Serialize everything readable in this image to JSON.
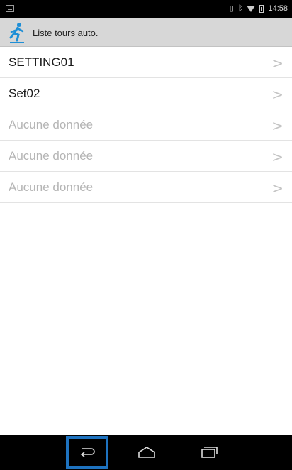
{
  "status_bar": {
    "time": "14:58",
    "icons": [
      "notification-icon",
      "vibrate-icon",
      "bluetooth-icon",
      "wifi-icon",
      "battery-icon"
    ]
  },
  "action_bar": {
    "title": "Liste tours auto.",
    "app_icon": "runner-icon"
  },
  "list": {
    "items": [
      {
        "label": "SETTING01",
        "empty": false
      },
      {
        "label": "Set02",
        "empty": false
      },
      {
        "label": "Aucune donnée",
        "empty": true
      },
      {
        "label": "Aucune donnée",
        "empty": true
      },
      {
        "label": "Aucune donnée",
        "empty": true
      }
    ],
    "chevron": ">"
  },
  "nav_bar": {
    "buttons": [
      "back-icon",
      "home-icon",
      "recents-icon"
    ],
    "highlight_color": "#1e73c0"
  }
}
